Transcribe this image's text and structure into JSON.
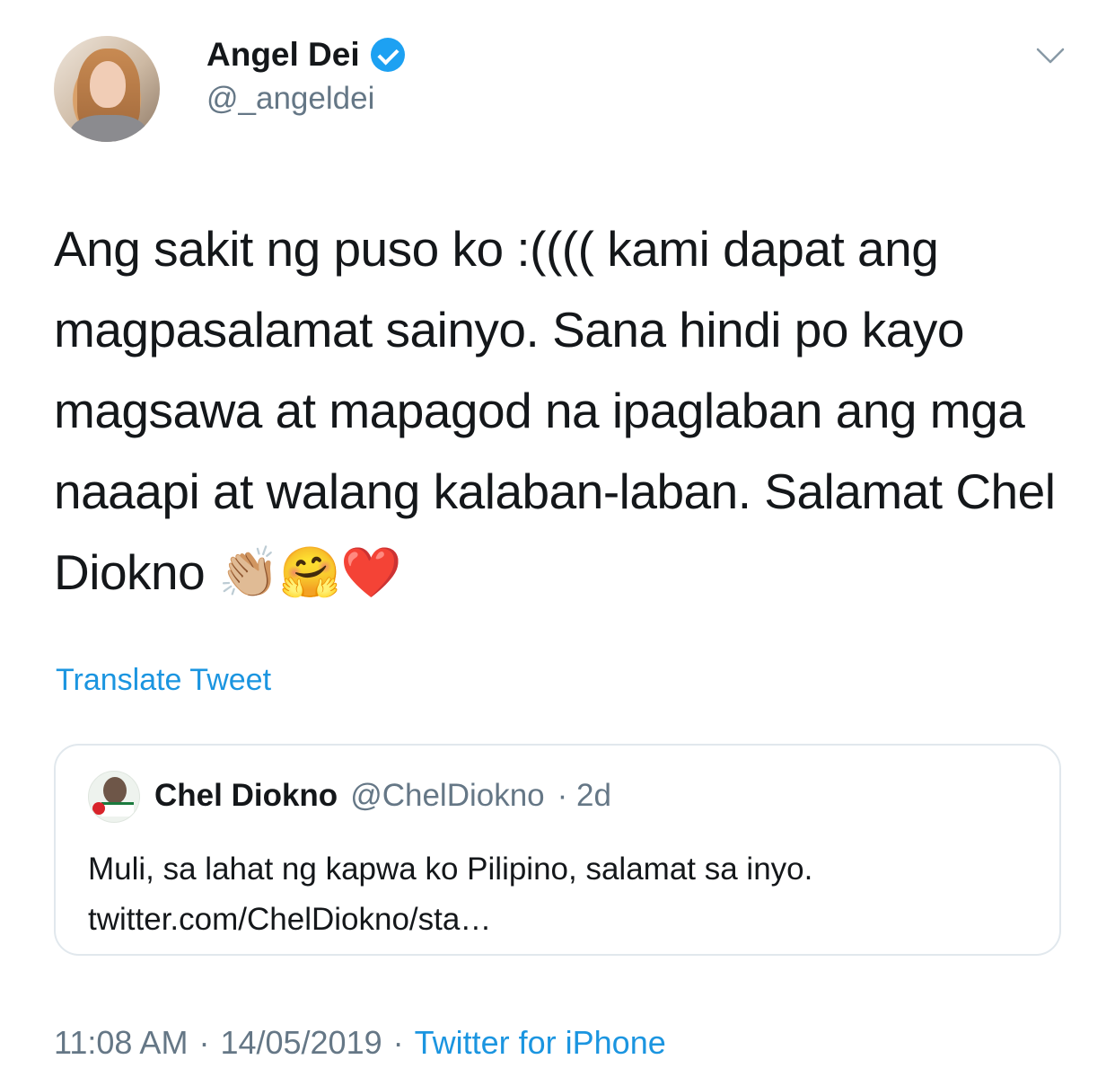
{
  "author": {
    "name": "Angel Dei",
    "handle": "@_angeldei",
    "verified": true
  },
  "tweet": {
    "text": "Ang sakit ng puso ko :(((( kami dapat ang magpasalamat sainyo. Sana hindi po kayo magsawa at mapagod na ipaglaban ang mga naaapi at walang kalaban-laban. Salamat Chel Diokno 👏🏼🤗❤️",
    "translate_label": "Translate Tweet"
  },
  "quoted": {
    "name": "Chel Diokno",
    "handle": "@ChelDiokno",
    "time": "· 2d",
    "text": "Muli, sa lahat ng kapwa ko Pilipino, salamat sa inyo. twitter.com/ChelDiokno/sta…"
  },
  "footer": {
    "time": "11:08 AM",
    "sep1": "·",
    "date": "14/05/2019",
    "sep2": "·",
    "source": "Twitter for iPhone"
  },
  "colors": {
    "accent": "#1b95e0",
    "verified": "#1da1f2",
    "secondary": "#657786",
    "border": "#e1e8ed"
  },
  "icons": [
    "verified-badge-icon",
    "chevron-down-icon"
  ]
}
